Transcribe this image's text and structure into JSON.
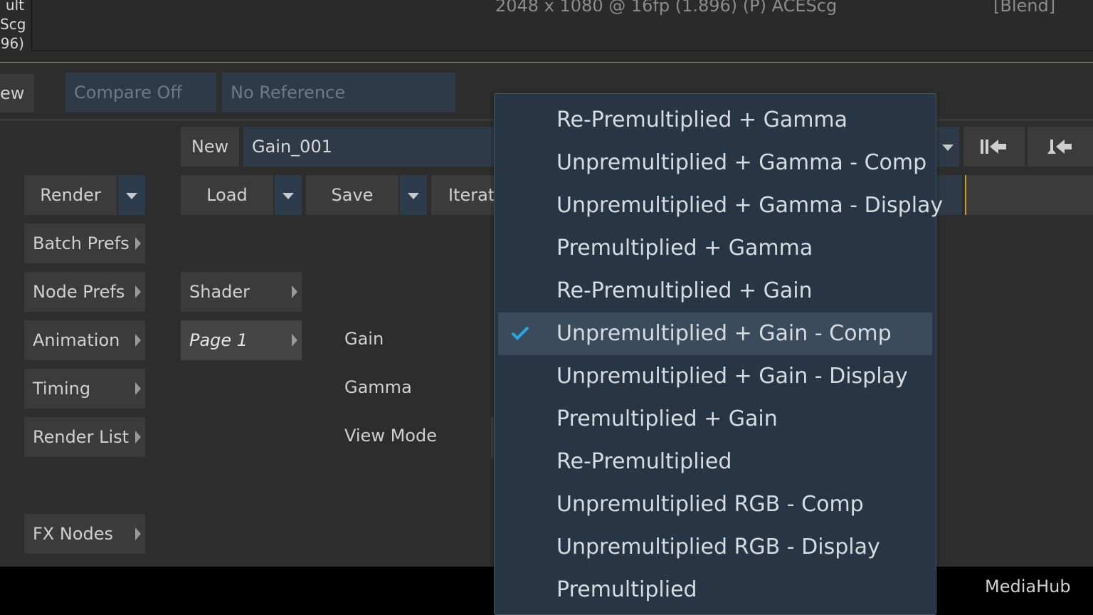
{
  "viewer": {
    "left_text": "ult\nScg\n96)",
    "format": "2048 x 1080 @ 16fp (1.896) (P) ACEScg",
    "blend": "[Blend]"
  },
  "toolbar2": {
    "view_tab": "ew",
    "compare": "Compare Off",
    "reference": "No Reference"
  },
  "setup": {
    "new_label": "New",
    "name_value": "Gain_001",
    "render": "Render",
    "load": "Load",
    "save": "Save",
    "iterate": "Iterat"
  },
  "sidebar": {
    "items": [
      "Batch Prefs",
      "Node Prefs",
      "Animation",
      "Timing",
      "Render List",
      "FX Nodes"
    ]
  },
  "pages": {
    "shader": "Shader",
    "page1": "Page 1"
  },
  "params": {
    "gain": "Gain",
    "gamma": "Gamma",
    "view_mode": "View Mode"
  },
  "dropdown": {
    "selected_index": 5,
    "options": [
      "Re-Premultiplied + Gamma",
      "Unpremultiplied + Gamma - Comp",
      "Unpremultiplied + Gamma - Display",
      "Premultiplied + Gamma",
      "Re-Premultiplied + Gain",
      "Unpremultiplied + Gain - Comp",
      "Unpremultiplied + Gain - Display",
      "Premultiplied + Gain",
      "Re-Premultiplied",
      "Unpremultiplied RGB - Comp",
      "Unpremultiplied RGB - Display",
      "Premultiplied"
    ]
  },
  "footer": {
    "mediahub": "MediaHub"
  },
  "colors": {
    "accent_check": "#29a8e0",
    "field_bg": "#2e3a47",
    "menu_bg": "#273544",
    "menu_selected": "#3a4b5c",
    "viewer_border": "#b8862a"
  },
  "icons": {
    "goto_start": "goto-start-icon",
    "step_back": "step-back-icon",
    "check": "checkmark-icon"
  }
}
